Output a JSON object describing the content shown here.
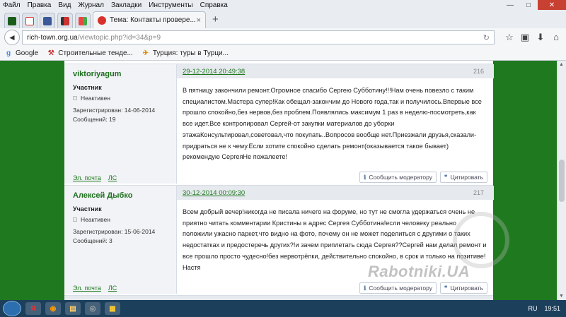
{
  "menu": [
    "Файл",
    "Правка",
    "Вид",
    "Журнал",
    "Закладки",
    "Инструменты",
    "Справка"
  ],
  "window_controls": {
    "minimize": "—",
    "maximize": "□",
    "close": "✕"
  },
  "tabs": {
    "active_title": "Тема: Контакты провере...",
    "close_glyph": "×",
    "new_tab_glyph": "+"
  },
  "nav": {
    "back_glyph": "◄",
    "url_host": "rich-town.org.ua",
    "url_path": "/viewtopic.php?id=34&p=9",
    "reload_glyph": "↻",
    "icons": [
      "☆",
      "▣",
      "⬇",
      "⌂"
    ]
  },
  "bookmarks": [
    {
      "label": "Google",
      "icon": "g-icon"
    },
    {
      "label": "Строительные тенде...",
      "icon": "tender-icon"
    },
    {
      "label": "Турция: туры в Турци...",
      "icon": "travel-icon"
    }
  ],
  "posts": [
    {
      "author": "viktoriyagum",
      "role": "Участник",
      "status": "Неактивен",
      "registered": "Зарегистрирован: 14-06-2014",
      "messages": "Сообщений: 19",
      "date": "29-12-2014 20:49:38",
      "number": "216",
      "text": "В пятницу закончили ремонт.Огромное спасибо Сергею Субботину!!!Нам очень повезло с таким специалистом.Мастера супер!Как обещал-закончим до Нового года,так и получилось.Впервые все прошло спокойно,без нервов,без проблем.Появлялись максимум 1 раз в неделю-посмотреть,как все идет.Все контролировал Сергей-от закупки материалов до уборки этажаКонсультировал,советовал,что покупать..Вопросов вообще нет.Приезжали друзья,сказали-придраться не к чему.Если хотите спокойно сделать ремонт(оказывается такое бывает) рекомендую СергеяНе пожалеете!",
      "email_link": "Эл. почта",
      "pm_link": "ЛС",
      "report_label": "Сообщить модератору",
      "quote_label": "Цитировать"
    },
    {
      "author": "Алексей Дыбко",
      "role": "Участник",
      "status": "Неактивен",
      "registered": "Зарегистрирован: 15-06-2014",
      "messages": "Сообщений: 3",
      "date": "30-12-2014 00:09:30",
      "number": "217",
      "text": "Всем добрый вечер!никогда не писала ничего на форуме, но тут не смогла удержаться очень не приятно читать комментарии Кристины в адрес Сергея Субботина!если человеку реально положили ужасно паркет,что видно на фото, почему он не может поделиться с другими о таких недостатках и предостеречь других?!и зачем приплетать сюда Сергея??Сергей нам делал ремонт и все прошло просто чудесно!без нервотрёпки, действительно спокойно, в срок и только на позитиве!Настя",
      "email_link": "Эл. почта",
      "pm_link": "ЛС",
      "report_label": "Сообщить модератору",
      "quote_label": "Цитировать"
    }
  ],
  "watermark": "Rabotniki.UA",
  "taskbar": {
    "apps": [
      "Я",
      "◉",
      "▤",
      "◎",
      "▦"
    ],
    "lang": "RU",
    "clock": "19:51"
  },
  "colors": {
    "forum_green": "#1f7a1f",
    "taskbar": "#1c3f5c",
    "close_red": "#c84031"
  }
}
